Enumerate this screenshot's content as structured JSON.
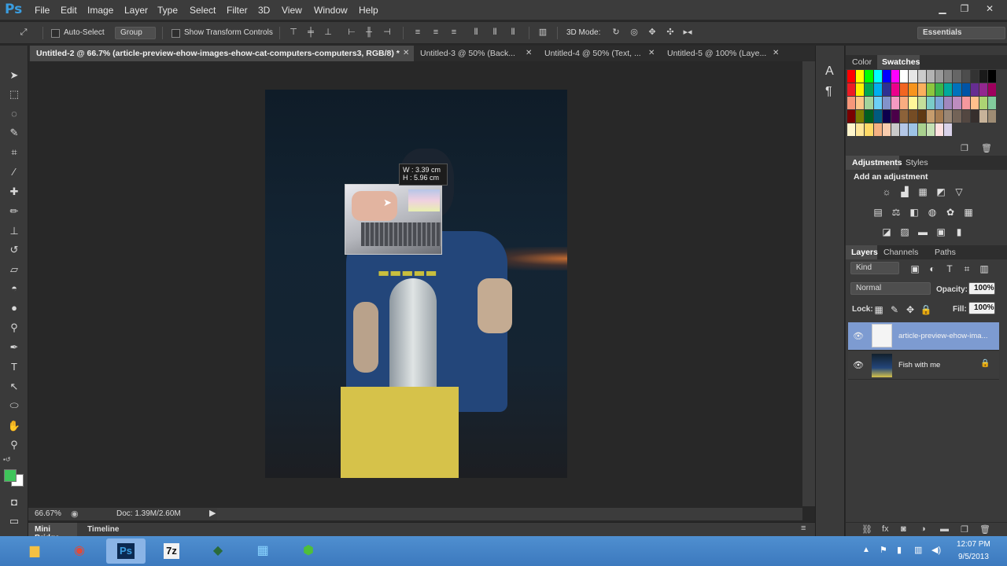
{
  "app": {
    "logo": "Ps",
    "menus": [
      "File",
      "Edit",
      "Image",
      "Layer",
      "Type",
      "Select",
      "Filter",
      "3D",
      "View",
      "Window",
      "Help"
    ]
  },
  "options": {
    "auto_select": "Auto-Select",
    "group": "Group",
    "show_transform": "Show Transform Controls",
    "mode_3d": "3D Mode:",
    "workspace": "Essentials"
  },
  "tabs": [
    {
      "label": "Untitled-2 @ 66.7% (article-preview-ehow-images-ehow-cat-computers-computers3, RGB/8) *",
      "active": true
    },
    {
      "label": "Untitled-3 @ 50% (Back...",
      "active": false
    },
    {
      "label": "Untitled-4 @ 50% (Text, ...",
      "active": false
    },
    {
      "label": "Untitled-5 @ 100% (Laye...",
      "active": false
    }
  ],
  "canvas": {
    "tooltip_w": "3.39 cm",
    "tooltip_h": "5.96 cm",
    "tooltip_w_label": "W :",
    "tooltip_h_label": "H :"
  },
  "status": {
    "zoom": "66.67%",
    "doc": "Doc: 1.39M/2.60M"
  },
  "bottom_tabs": [
    "Mini Bridge",
    "Timeline"
  ],
  "panels": {
    "color_tabs": [
      "Color",
      "Swatches"
    ],
    "adjust_tabs": [
      "Adjustments",
      "Styles"
    ],
    "adjust_title": "Add an adjustment",
    "layer_tabs": [
      "Layers",
      "Channels",
      "Paths"
    ],
    "kind": "Kind",
    "blend": "Normal",
    "opacity_label": "Opacity:",
    "opacity": "100%",
    "lock_label": "Lock:",
    "fill_label": "Fill:",
    "fill": "100%",
    "layers": [
      {
        "name": "article-preview-ehow-ima...",
        "selected": true
      },
      {
        "name": "Fish with me",
        "selected": false
      }
    ]
  },
  "taskbar": {
    "time": "12:07 PM",
    "date": "9/5/2013",
    "apps": [
      "folder-icon",
      "chrome-icon",
      "photoshop-icon",
      "7zip-icon",
      "app-icon",
      "explorer-icon",
      "network-icon"
    ]
  },
  "colors": {
    "accent": "#7d9bd1",
    "ps_blue": "#3a9de0",
    "foreground": "#3ec45a",
    "background": "#ffffff"
  }
}
